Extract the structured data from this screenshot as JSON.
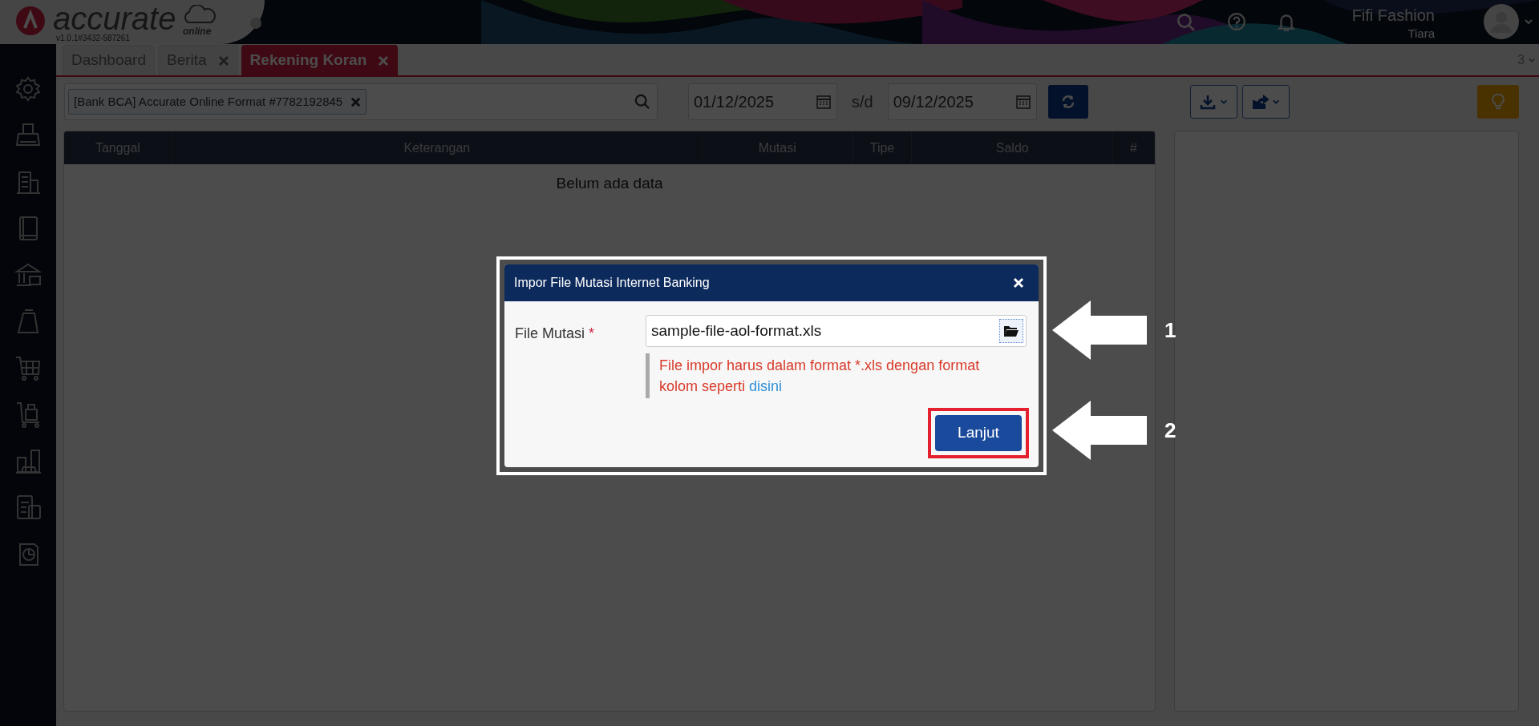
{
  "app": {
    "logo_text": "accurate",
    "logo_sub": "online",
    "version": "v1.0.1#3432-587261"
  },
  "user": {
    "company": "Fifi Fashion",
    "name": "Tiara"
  },
  "tabs": [
    {
      "label": "Dashboard",
      "selected": false,
      "closable": false
    },
    {
      "label": "Berita",
      "selected": false,
      "closable": true
    },
    {
      "label": "Rekening Koran",
      "selected": true,
      "closable": true
    }
  ],
  "tab_count": "3",
  "filter": {
    "bank_tag": "[Bank BCA] Accurate Online Format #7782192845",
    "date_from": "01/12/2025",
    "date_separator": "s/d",
    "date_to": "09/12/2025"
  },
  "table": {
    "columns": [
      "Tanggal",
      "Keterangan",
      "Mutasi",
      "Tipe",
      "Saldo",
      "#"
    ],
    "empty_text": "Belum ada data"
  },
  "dialog": {
    "title": "Impor File Mutasi Internet Banking",
    "field_label": "File Mutasi",
    "required_mark": "*",
    "file_value": "sample-file-aol-format.xls",
    "help_text": "File impor harus dalam format *.xls dengan format kolom seperti",
    "help_link": "disini",
    "button": "Lanjut"
  },
  "annotations": [
    {
      "label": "1"
    },
    {
      "label": "2"
    }
  ]
}
